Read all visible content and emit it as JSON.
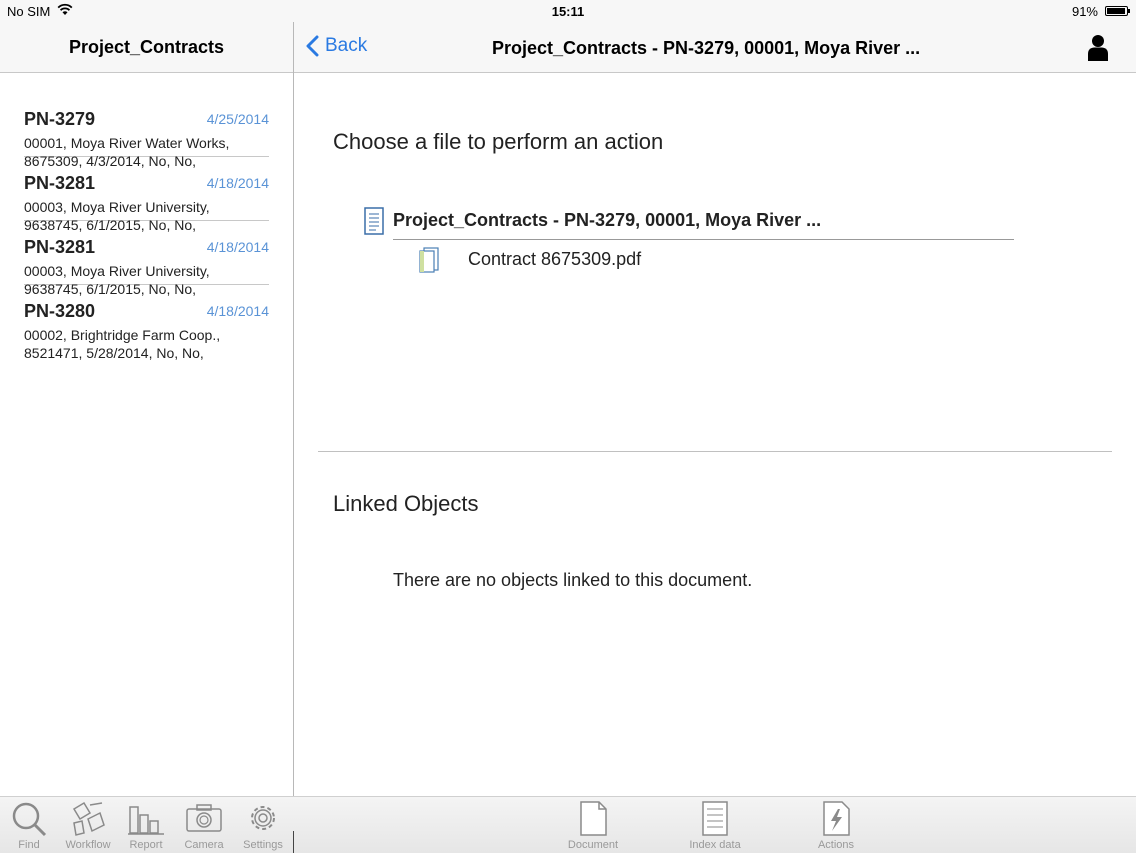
{
  "status": {
    "carrier": "No SIM",
    "time": "15:11",
    "battery": "91%"
  },
  "sidebar": {
    "title": "Project_Contracts",
    "records": [
      {
        "id": "PN-3279",
        "date": "4/25/2014",
        "line1": "00001, Moya River Water Works,",
        "line2": "8675309, 4/3/2014, No, No,"
      },
      {
        "id": "PN-3281",
        "date": "4/18/2014",
        "line1": "00003, Moya River University,",
        "line2": "9638745, 6/1/2015, No, No,"
      },
      {
        "id": "PN-3281",
        "date": "4/18/2014",
        "line1": "00003, Moya River University,",
        "line2": "9638745, 6/1/2015, No, No,"
      },
      {
        "id": "PN-3280",
        "date": "4/18/2014",
        "line1": "00002, Brightridge Farm Coop.,",
        "line2": "8521471, 5/28/2014, No, No,"
      }
    ]
  },
  "header": {
    "back_label": "Back",
    "title": "Project_Contracts - PN-3279, 00001, Moya River ..."
  },
  "main": {
    "choose_title": "Choose a file to perform an action",
    "file_title": "Project_Contracts - PN-3279, 00001, Moya River ...",
    "child_file": "Contract 8675309.pdf",
    "linked_title": "Linked Objects",
    "linked_empty": "There are no objects linked to this document."
  },
  "toolbar": {
    "left": [
      {
        "label": "Find",
        "icon": "search-icon"
      },
      {
        "label": "Workflow",
        "icon": "workflow-icon"
      },
      {
        "label": "Report",
        "icon": "report-icon"
      },
      {
        "label": "Camera",
        "icon": "camera-icon"
      },
      {
        "label": "Settings",
        "icon": "gear-icon"
      }
    ],
    "right": [
      {
        "label": "Document",
        "icon": "document-icon"
      },
      {
        "label": "Index data",
        "icon": "index-data-icon"
      },
      {
        "label": "Actions",
        "icon": "actions-icon"
      }
    ]
  },
  "colors": {
    "accent": "#2a7ae2",
    "date": "#5a93d6"
  }
}
